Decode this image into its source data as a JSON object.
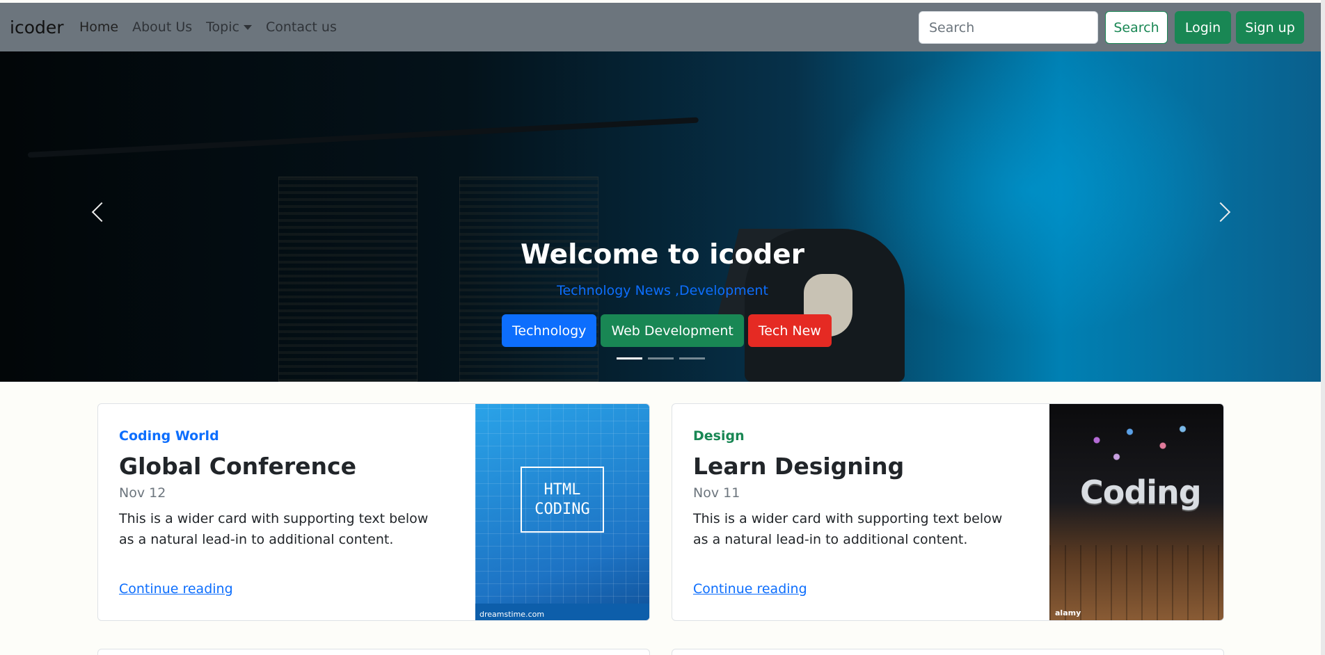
{
  "navbar": {
    "brand": "icoder",
    "links": [
      "Home",
      "About Us",
      "Topic",
      "Contact us"
    ],
    "search_placeholder": "Search",
    "search_button": "Search",
    "login_button": "Login",
    "signup_button": "Sign up",
    "color": "#6c757d",
    "accent": "#198754"
  },
  "hero": {
    "title": "Welcome to icoder",
    "subtitle": "Technology News ,Development",
    "buttons": [
      {
        "label": "Technology",
        "color": "#0d6efd"
      },
      {
        "label": "Web Development",
        "color": "#198754"
      },
      {
        "label": "Tech New",
        "color": "#e52a23"
      }
    ],
    "slide_count": 3,
    "active_slide": 1,
    "prev_icon": "chevron-left-icon",
    "next_icon": "chevron-right-icon"
  },
  "cards": [
    {
      "category": "Coding World",
      "category_color": "#0d6efd",
      "title": "Global Conference",
      "date": "Nov 12",
      "text": "This is a wider card with supporting text below as a natural lead-in to additional content.",
      "link": "Continue reading",
      "image_title": "HTML CODING",
      "image_credit": "dreamstime.com"
    },
    {
      "category": "Design",
      "category_color": "#198754",
      "title": "Learn Designing",
      "date": "Nov 11",
      "text": "This is a wider card with supporting text below as a natural lead-in to additional content.",
      "link": "Continue reading",
      "image_title": "Coding",
      "image_credit": "alamy"
    }
  ]
}
